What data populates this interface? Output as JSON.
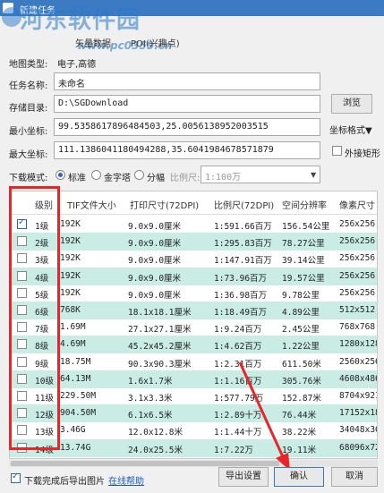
{
  "window": {
    "title": "新建任务",
    "watermark": "河东软件园",
    "watermark_url": "www.pc0359.cn"
  },
  "map_tabs": [
    "矢量数据",
    "POI(兴趣点)"
  ],
  "map_type": {
    "label": "地图类型:",
    "value": "电子,高德"
  },
  "task_name": {
    "label": "任务名称:",
    "value": "未命名"
  },
  "save_dir": {
    "label": "存储目录:",
    "value": "D:\\SGDownload",
    "browse": "浏览"
  },
  "min_coord": {
    "label": "最小坐标:",
    "value": "99.5358617896484503,25.0056138952003515",
    "format_btn": "坐标格式▼"
  },
  "max_coord": {
    "label": "最大坐标:",
    "value": "111.1386041180494288,35.6041984678571879",
    "external_rect": "外接矩形"
  },
  "download_mode": {
    "label": "下载模式:",
    "options": [
      "标准",
      "金字塔",
      "分幅"
    ],
    "selected": 0,
    "scale_label": "比例尺:",
    "scale_value": "1:100万"
  },
  "table": {
    "headers": [
      "级别",
      "TIF文件大小",
      "打印尺寸(72DPI)",
      "比例尺(72DPI)",
      "空间分辨率",
      "像素尺寸"
    ],
    "rows": [
      {
        "checked": true,
        "level": "1级",
        "tif": "192K",
        "print": "9.0x9.0厘米",
        "scale": "1:591.66百万",
        "res": "156.54公里",
        "px": "256x256"
      },
      {
        "checked": false,
        "level": "2级",
        "tif": "192K",
        "print": "9.0x9.0厘米",
        "scale": "1:295.83百万",
        "res": "78.27公里",
        "px": "256x256"
      },
      {
        "checked": false,
        "level": "3级",
        "tif": "192K",
        "print": "9.0x9.0厘米",
        "scale": "1:147.91百万",
        "res": "39.14公里",
        "px": "256x256"
      },
      {
        "checked": false,
        "level": "4级",
        "tif": "192K",
        "print": "9.0x9.0厘米",
        "scale": "1:73.96百万",
        "res": "19.57公里",
        "px": "256x256"
      },
      {
        "checked": false,
        "level": "5级",
        "tif": "192K",
        "print": "9.0x9.0厘米",
        "scale": "1:36.98百万",
        "res": "9.78公里",
        "px": "256x256"
      },
      {
        "checked": false,
        "level": "6级",
        "tif": "768K",
        "print": "18.1x18.1厘米",
        "scale": "1:18.49百万",
        "res": "4.89公里",
        "px": "512x512"
      },
      {
        "checked": false,
        "level": "7级",
        "tif": "1.69M",
        "print": "27.1x27.1厘米",
        "scale": "1:9.24百万",
        "res": "2.45公里",
        "px": "768x768"
      },
      {
        "checked": false,
        "level": "8级",
        "tif": "4.69M",
        "print": "45.2x45.2厘米",
        "scale": "1:4.62百万",
        "res": "1.22公里",
        "px": "1280x1280"
      },
      {
        "checked": false,
        "level": "9级",
        "tif": "18.75M",
        "print": "90.3x90.3厘米",
        "scale": "1:2.31百万",
        "res": "611.50米",
        "px": "2560x2560"
      },
      {
        "checked": false,
        "level": "10级",
        "tif": "64.13M",
        "print": "1.6x1.7米",
        "scale": "1:1.16百万",
        "res": "305.76米",
        "px": "4608x4864"
      },
      {
        "checked": false,
        "level": "11级",
        "tif": "229.50M",
        "print": "3.1x3.3米",
        "scale": "1:577.79万",
        "res": "152.87米",
        "px": "8704x9216"
      },
      {
        "checked": false,
        "level": "12级",
        "tif": "904.50M",
        "print": "6.1x6.5米",
        "scale": "1:2.89十万",
        "res": "76.44米",
        "px": "17152x18176"
      },
      {
        "checked": false,
        "level": "13级",
        "tif": "3.46G",
        "print": "12.0x12.8米",
        "scale": "1:1.44十万",
        "res": "38.22米",
        "px": "34048x36096"
      },
      {
        "checked": false,
        "level": "14级",
        "tif": "13.74G",
        "print": "24.0x25.5米",
        "scale": "1:7.22万",
        "res": "19.11米",
        "px": "68096x72192"
      }
    ]
  },
  "footer": {
    "export_after": "下载完成后导出图片",
    "online_help": "在线帮助",
    "export_settings": "导出设置",
    "ok": "确认",
    "cancel": "取消"
  },
  "colors": {
    "accent": "#3c7bc4",
    "row_alt": "#c9ece4",
    "annotation": "#e8262a"
  }
}
